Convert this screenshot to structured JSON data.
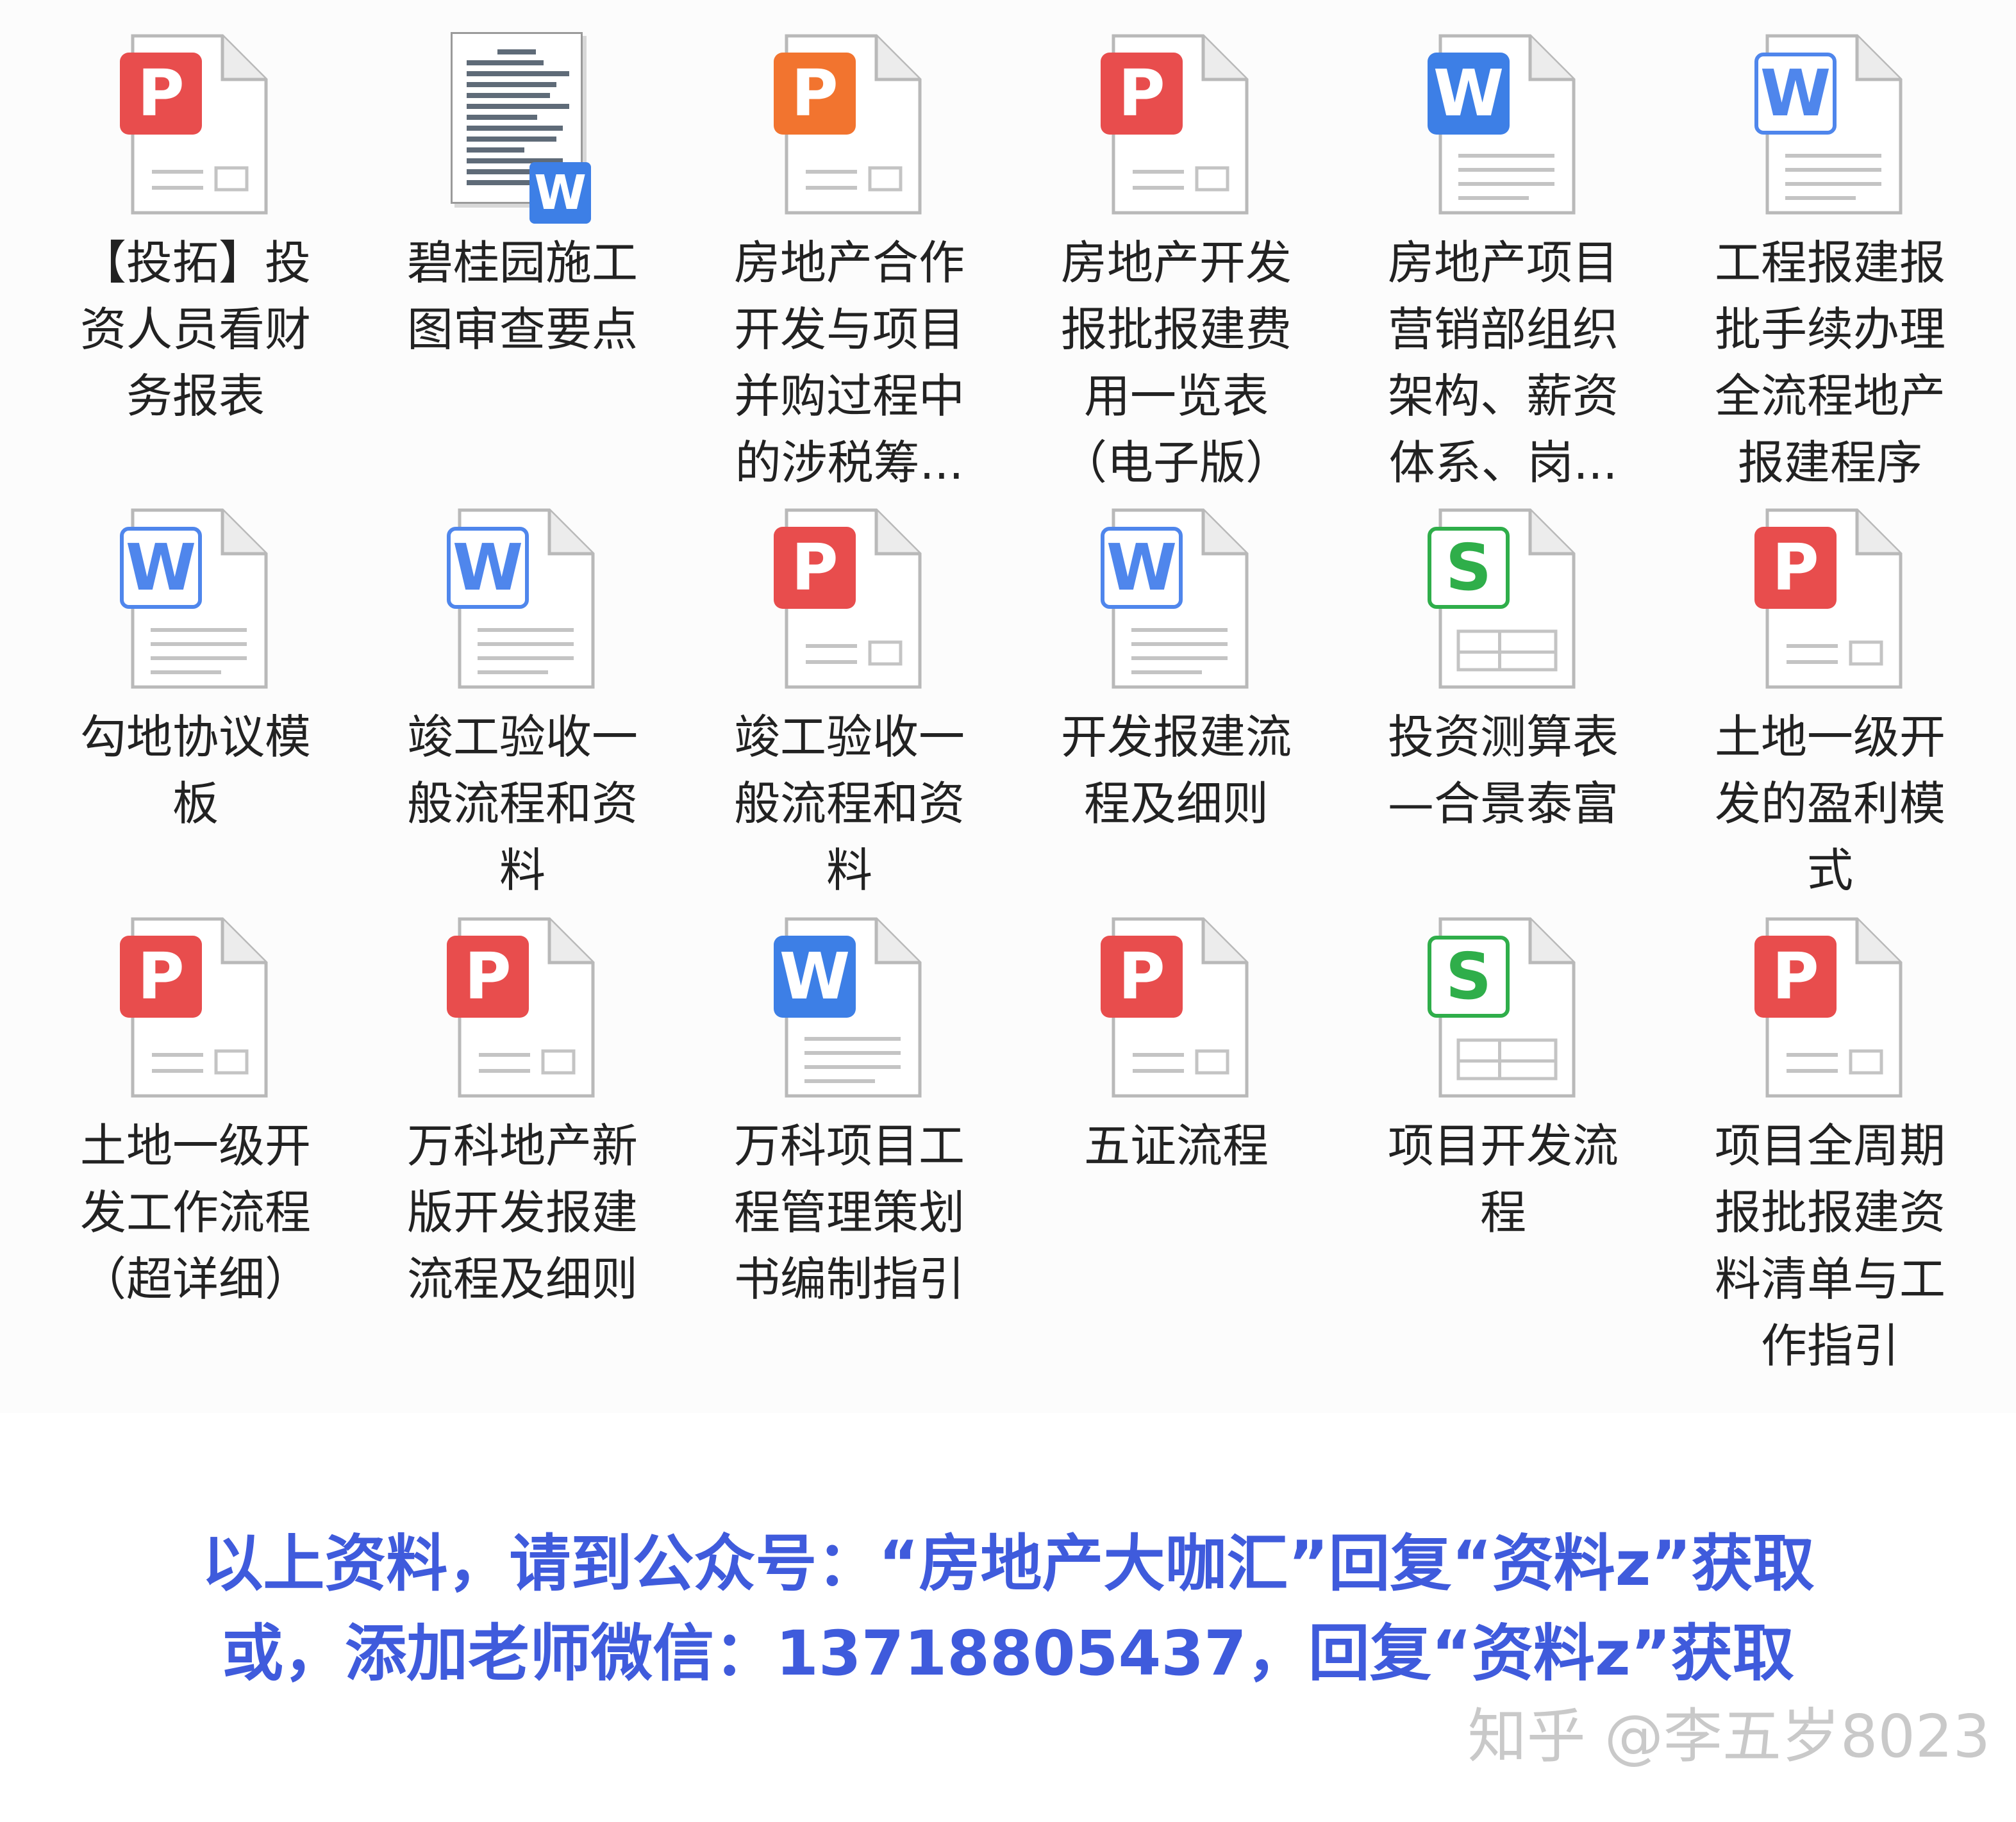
{
  "files": [
    {
      "name": "【投拓】投资人员看财务报表",
      "icon": "pdf-icon",
      "kind": "pdf"
    },
    {
      "name": "碧桂园施工图审查要点",
      "icon": "document-thumbnail-icon",
      "kind": "thumb"
    },
    {
      "name": "房地产合作开发与项目并购过程中的涉税筹...",
      "icon": "ppt-icon",
      "kind": "ppt"
    },
    {
      "name": "房地产开发报批报建费用一览表（电子版）",
      "icon": "pdf-icon",
      "kind": "pdf"
    },
    {
      "name": "房地产项目营销部组织架构、薪资体系、岗...",
      "icon": "word-icon",
      "kind": "word"
    },
    {
      "name": "工程报建报批手续办理全流程地产报建程序",
      "icon": "word-icon",
      "kind": "word-outline"
    },
    {
      "name": "勾地协议模板",
      "icon": "word-icon",
      "kind": "word-outline"
    },
    {
      "name": "竣工验收一般流程和资料",
      "icon": "word-icon",
      "kind": "word-outline"
    },
    {
      "name": "竣工验收一般流程和资料",
      "icon": "pdf-icon",
      "kind": "pdf"
    },
    {
      "name": "开发报建流程及细则",
      "icon": "word-icon",
      "kind": "word-outline"
    },
    {
      "name": "投资测算表—合景泰富",
      "icon": "excel-icon",
      "kind": "excel-outline"
    },
    {
      "name": "土地一级开发的盈利模式",
      "icon": "pdf-icon",
      "kind": "pdf"
    },
    {
      "name": "土地一级开发工作流程（超详细）",
      "icon": "pdf-icon",
      "kind": "pdf"
    },
    {
      "name": "万科地产新版开发报建流程及细则",
      "icon": "pdf-icon",
      "kind": "pdf"
    },
    {
      "name": "万科项目工程管理策划书编制指引",
      "icon": "word-icon",
      "kind": "word"
    },
    {
      "name": "五证流程",
      "icon": "pdf-icon",
      "kind": "pdf"
    },
    {
      "name": "项目开发流程",
      "icon": "excel-icon",
      "kind": "excel-outline"
    },
    {
      "name": "项目全周期报批报建资料清单与工作指引",
      "icon": "pdf-icon",
      "kind": "pdf"
    }
  ],
  "badge_letters": {
    "pdf": "P",
    "ppt": "P",
    "word": "W",
    "word-outline": "W",
    "excel-outline": "S"
  },
  "footer": {
    "line1": "以上资料，请到公众号：“房地产大咖汇”回复“资料z”获取",
    "line2": "或，添加老师微信：13718805437，回复“资料z”获取"
  },
  "watermark": "知乎 @李五岁8023",
  "colors": {
    "pdf": "#e84d4d",
    "ppt": "#f2742f",
    "word": "#3d7fe6",
    "excel": "#2fae4a",
    "footer_text": "#3f5bdc"
  }
}
